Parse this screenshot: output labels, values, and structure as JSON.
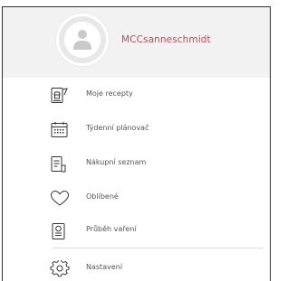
{
  "profile": {
    "username": "MCCsanneschmidt",
    "avatar_icon": "user-icon"
  },
  "menu": {
    "items": [
      {
        "label": "Moje recepty",
        "icon": "cookbook-icon"
      },
      {
        "label": "Týdenní plánovač",
        "icon": "calendar-icon"
      },
      {
        "label": "Nákupní seznam",
        "icon": "shopping-list-icon"
      },
      {
        "label": "Oblíbené",
        "icon": "heart-icon"
      },
      {
        "label": "Průběh vaření",
        "icon": "cooking-progress-icon"
      },
      {
        "label": "Nastavení",
        "icon": "gear-icon"
      }
    ]
  },
  "colors": {
    "accent": "#c14a5a",
    "icon": "#333333",
    "profile_bg": "#f2f2f2"
  }
}
